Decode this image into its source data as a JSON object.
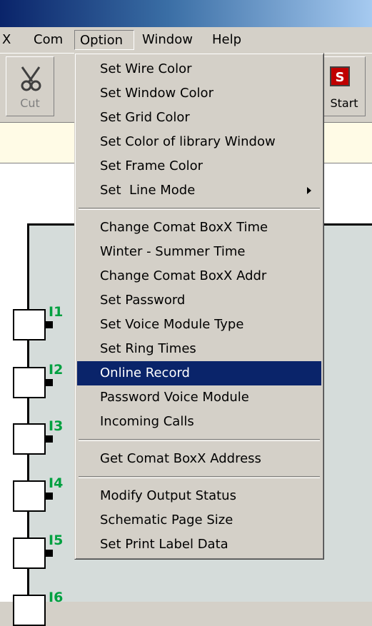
{
  "menubar": {
    "items": [
      {
        "label": "X"
      },
      {
        "label": "Com"
      },
      {
        "label": "Option"
      },
      {
        "label": "Window"
      },
      {
        "label": "Help"
      }
    ]
  },
  "toolbar": {
    "cut_label": "Cut",
    "start_label": "Start"
  },
  "option_menu": {
    "group1": [
      {
        "label": "Set Wire Color"
      },
      {
        "label": "Set Window Color"
      },
      {
        "label": "Set Grid Color"
      },
      {
        "label": "Set Color of library Window"
      },
      {
        "label": "Set Frame Color"
      },
      {
        "label": "Set  Line Mode"
      }
    ],
    "group2": [
      {
        "label": "Change Comat BoxX Time"
      },
      {
        "label": "Winter - Summer Time"
      },
      {
        "label": "Change Comat BoxX Addr"
      },
      {
        "label": "Set Password"
      },
      {
        "label": "Set Voice Module Type"
      },
      {
        "label": "Set Ring Times"
      },
      {
        "label": "Online Record"
      },
      {
        "label": "Password Voice Module"
      },
      {
        "label": "Incoming Calls"
      }
    ],
    "group3": [
      {
        "label": "Get Comat BoxX Address"
      }
    ],
    "group4": [
      {
        "label": "Modify Output Status"
      },
      {
        "label": "Schematic Page Size"
      },
      {
        "label": "Set Print Label Data"
      }
    ],
    "selected": "Online Record"
  },
  "schematic": {
    "inputs": [
      "I1",
      "I2",
      "I3",
      "I4",
      "I5",
      "I6"
    ]
  },
  "colors": {
    "selection": "#0a246a",
    "input_label": "#00a040",
    "canvas": "#d5dcda"
  }
}
